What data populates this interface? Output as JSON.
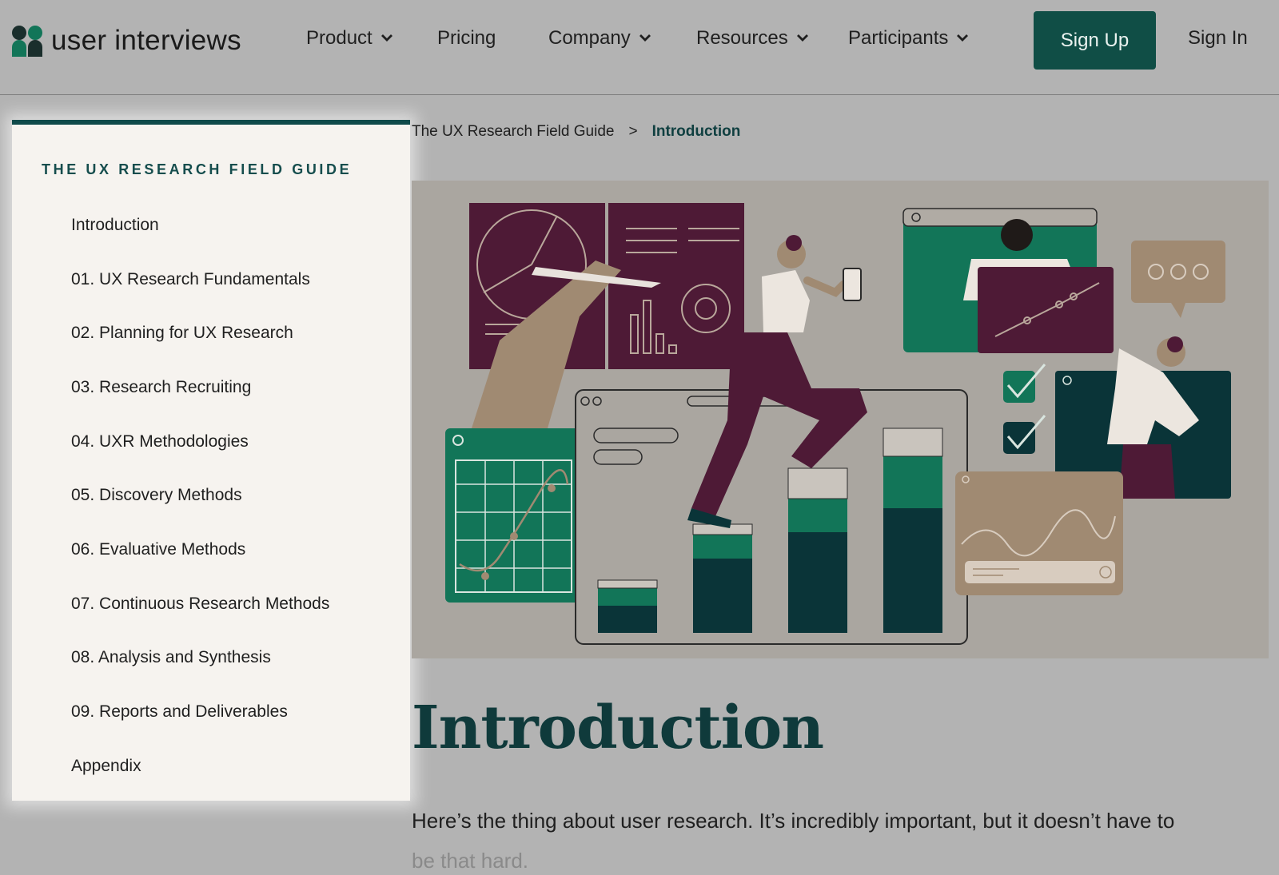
{
  "brand": {
    "name": "user interviews",
    "colors": {
      "primary": "#104e46",
      "plum": "#4e1a36",
      "green": "#127558",
      "tan": "#a08a72"
    }
  },
  "nav": {
    "items": [
      {
        "label": "Product",
        "has_dropdown": true
      },
      {
        "label": "Pricing",
        "has_dropdown": false
      },
      {
        "label": "Company",
        "has_dropdown": true
      },
      {
        "label": "Resources",
        "has_dropdown": true
      },
      {
        "label": "Participants",
        "has_dropdown": true
      }
    ],
    "signup_label": "Sign Up",
    "signin_label": "Sign In"
  },
  "sidebar": {
    "title": "THE UX RESEARCH FIELD GUIDE",
    "items": [
      "Introduction",
      "01. UX Research Fundamentals",
      "02. Planning for UX Research",
      "03. Research Recruiting",
      "04. UXR Methodologies",
      "05. Discovery Methods",
      "06. Evaluative Methods",
      "07. Continuous Research Methods",
      "08. Analysis and Synthesis",
      "09. Reports and Deliverables",
      "Appendix"
    ]
  },
  "breadcrumb": {
    "parent": "The UX Research Field Guide",
    "separator": ">",
    "current": "Introduction"
  },
  "main": {
    "title": "Introduction",
    "intro_visible": "Here’s the thing about user research. It’s incredibly important, but it doesn’t have to",
    "intro_faded": "be that hard."
  }
}
